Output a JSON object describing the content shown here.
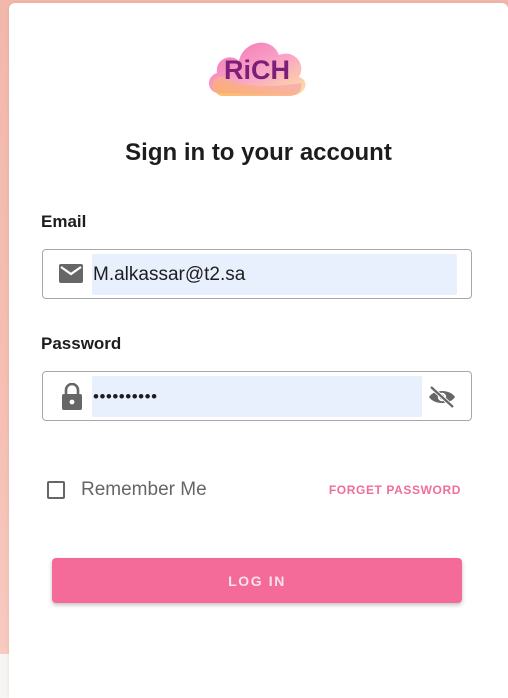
{
  "logo": {
    "text": "RiCH"
  },
  "title": "Sign in to your account",
  "email": {
    "label": "Email",
    "value": "M.alkassar@t2.sa",
    "icon": "mail-icon"
  },
  "password": {
    "label": "Password",
    "value": "••••••••••",
    "icon": "lock-icon",
    "toggle_icon": "eye-off-icon"
  },
  "remember": {
    "label": "Remember Me",
    "checked": false
  },
  "forget_label": "FORGET PASSWORD",
  "login_label": "LOG IN",
  "colors": {
    "accent": "#f46b9a",
    "link": "#ee6e9d",
    "autofill": "#e8f0fe",
    "background": "#f3b8ac"
  }
}
